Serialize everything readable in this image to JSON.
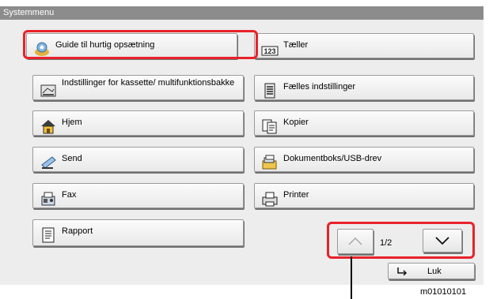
{
  "window": {
    "title": "Systemmenu"
  },
  "menu": {
    "left": [
      {
        "label": "Guide til hurtig opsætning",
        "icon": "quick-setup-icon"
      },
      {
        "label": "Indstillinger for kassette/ multifunktionsbakke",
        "icon": "cassette-icon"
      },
      {
        "label": "Hjem",
        "icon": "home-icon"
      },
      {
        "label": "Send",
        "icon": "send-icon"
      },
      {
        "label": "Fax",
        "icon": "fax-icon"
      },
      {
        "label": "Rapport",
        "icon": "report-icon"
      }
    ],
    "right": [
      {
        "label": "Tæller",
        "icon": "counter-icon",
        "icon_text": "123"
      },
      {
        "label": "Fælles indstillinger",
        "icon": "common-settings-icon"
      },
      {
        "label": "Kopier",
        "icon": "copy-icon"
      },
      {
        "label": "Dokumentboks/USB-drev",
        "icon": "document-box-icon"
      },
      {
        "label": "Printer",
        "icon": "printer-icon"
      }
    ]
  },
  "pagination": {
    "current": "1/2"
  },
  "close_button": {
    "label": "Luk"
  },
  "footer": {
    "code": "m01010101"
  },
  "colors": {
    "highlight": "#e8222a",
    "titlebar": "#8c8c8c",
    "panel": "#ededed"
  }
}
